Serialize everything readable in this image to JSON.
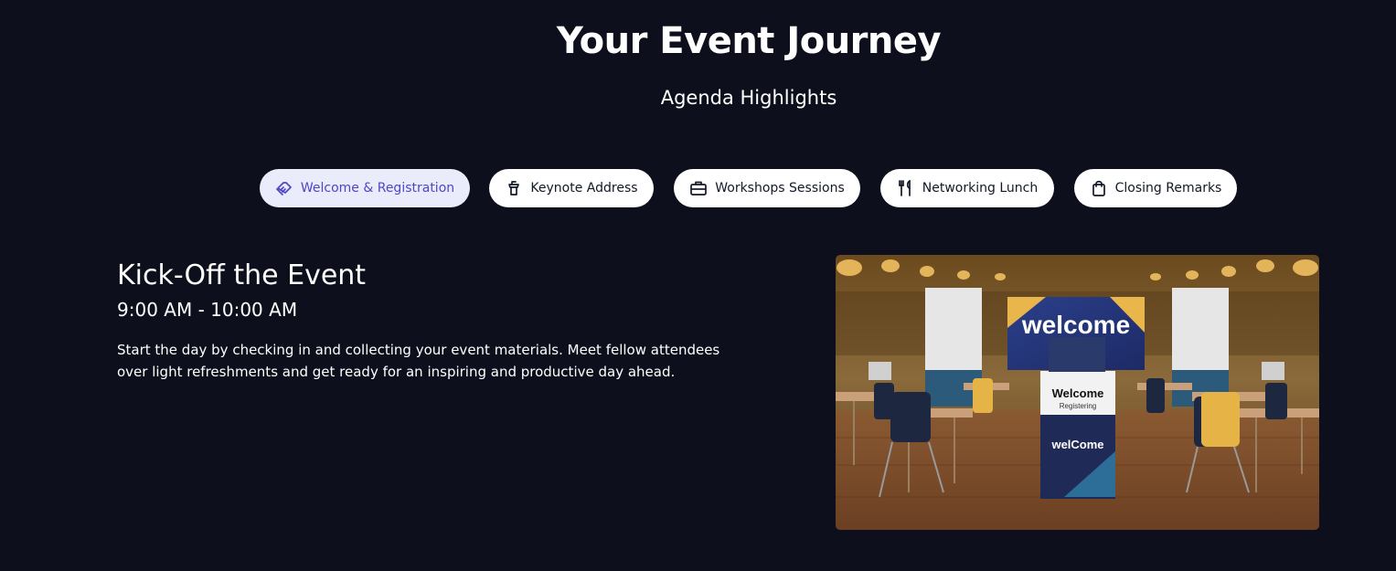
{
  "header": {
    "title": "Your Event Journey",
    "subtitle": "Agenda Highlights"
  },
  "tabs": [
    {
      "label": "Welcome & Registration",
      "icon": "handshake-icon",
      "active": true
    },
    {
      "label": "Keynote Address",
      "icon": "podium-icon",
      "active": false
    },
    {
      "label": "Workshops Sessions",
      "icon": "briefcase-icon",
      "active": false
    },
    {
      "label": "Networking Lunch",
      "icon": "utensils-icon",
      "active": false
    },
    {
      "label": "Closing Remarks",
      "icon": "shopping-bag-icon",
      "active": false
    }
  ],
  "session": {
    "title": "Kick-Off the Event",
    "time": "9:00 AM - 10:00 AM",
    "description": "Start the day by checking in and collecting your event materials. Meet fellow attendees over light refreshments and get ready for an inspiring and productive day ahead."
  },
  "image": {
    "banner_text": "welcome",
    "podium_title": "Welcome",
    "podium_subtitle": "Registering",
    "podium_lower_text": "welCome"
  },
  "colors": {
    "background": "#0d101c",
    "active_tab_bg": "#eaecfb",
    "active_tab_text": "#4f46c8",
    "tab_bg": "#ffffff"
  }
}
